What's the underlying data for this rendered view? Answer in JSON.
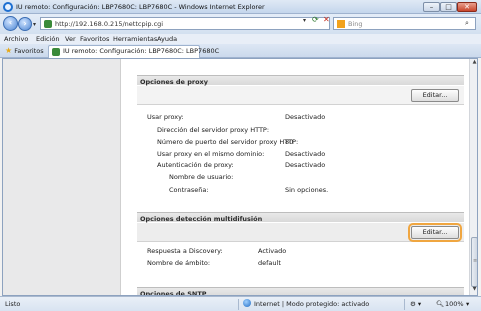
{
  "window": {
    "title": "IU remoto: Configuración: LBP7680C: LBP7680C - Windows Internet Explorer",
    "min": "–",
    "max": "□",
    "close": "✕"
  },
  "address": {
    "url": "http://192.168.0.215/nettcpip.cgi",
    "search_placeholder": "Bing"
  },
  "menu": [
    "Archivo",
    "Edición",
    "Ver",
    "Favoritos",
    "Herramientas",
    "Ayuda"
  ],
  "tabs": {
    "favorites_label": "Favoritos",
    "active_tab": "IU remoto: Configuración: LBP7680C: LBP7680C"
  },
  "proxy": {
    "title": "Opciones de proxy",
    "edit": "Editar...",
    "rows": [
      {
        "label": "Usar proxy:",
        "value": "Desactivado"
      },
      {
        "label": "Dirección del servidor proxy HTTP:",
        "value": ""
      },
      {
        "label": "Número de puerto del servidor proxy HTTP:",
        "value": "80"
      },
      {
        "label": "Usar proxy en el mismo dominio:",
        "value": "Desactivado"
      },
      {
        "label": "Autenticación de proxy:",
        "value": "Desactivado"
      },
      {
        "label": "Nombre de usuario:",
        "value": ""
      },
      {
        "label": "Contraseña:",
        "value": "Sin opciones."
      }
    ]
  },
  "multicast": {
    "title": "Opciones detección multidifusión",
    "edit": "Editar...",
    "rows": [
      {
        "label": "Respuesta a Discovery:",
        "value": "Activado"
      },
      {
        "label": "Nombre de ámbito:",
        "value": "default"
      }
    ]
  },
  "snmp": {
    "title": "Opciones de SNTP"
  },
  "status": {
    "left": "Listo",
    "zone": "Internet | Modo protegido: activado",
    "zoom": "100%"
  }
}
